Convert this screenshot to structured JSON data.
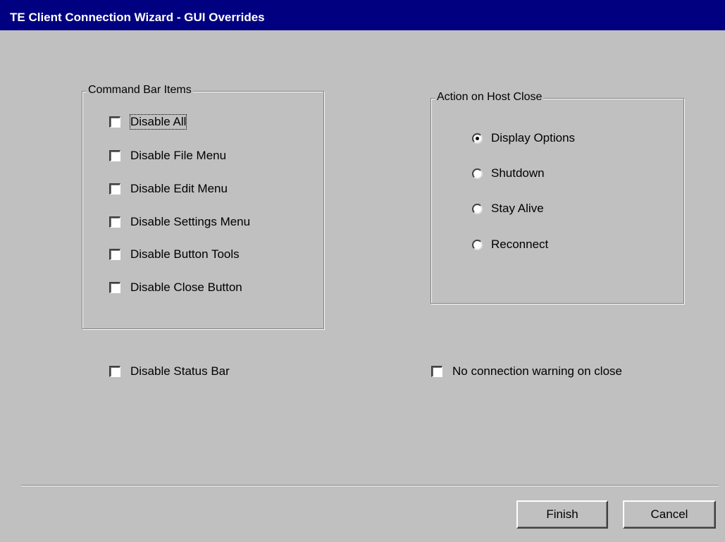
{
  "window": {
    "title": "TE Client Connection Wizard - GUI Overrides"
  },
  "command_bar": {
    "title": "Command Bar Items",
    "items": [
      {
        "label": "Disable All",
        "checked": false
      },
      {
        "label": "Disable File Menu",
        "checked": false
      },
      {
        "label": "Disable Edit Menu",
        "checked": false
      },
      {
        "label": "Disable Settings Menu",
        "checked": false
      },
      {
        "label": "Disable Button Tools",
        "checked": false
      },
      {
        "label": "Disable Close Button",
        "checked": false
      }
    ]
  },
  "host_close": {
    "title": "Action on Host Close",
    "options": [
      {
        "label": "Display Options",
        "selected": true
      },
      {
        "label": "Shutdown",
        "selected": false
      },
      {
        "label": "Stay Alive",
        "selected": false
      },
      {
        "label": "Reconnect",
        "selected": false
      }
    ]
  },
  "status_bar": {
    "label": "Disable Status Bar",
    "checked": false
  },
  "close_warning": {
    "label": "No connection warning on close",
    "checked": false
  },
  "buttons": {
    "finish": "Finish",
    "cancel": "Cancel"
  }
}
